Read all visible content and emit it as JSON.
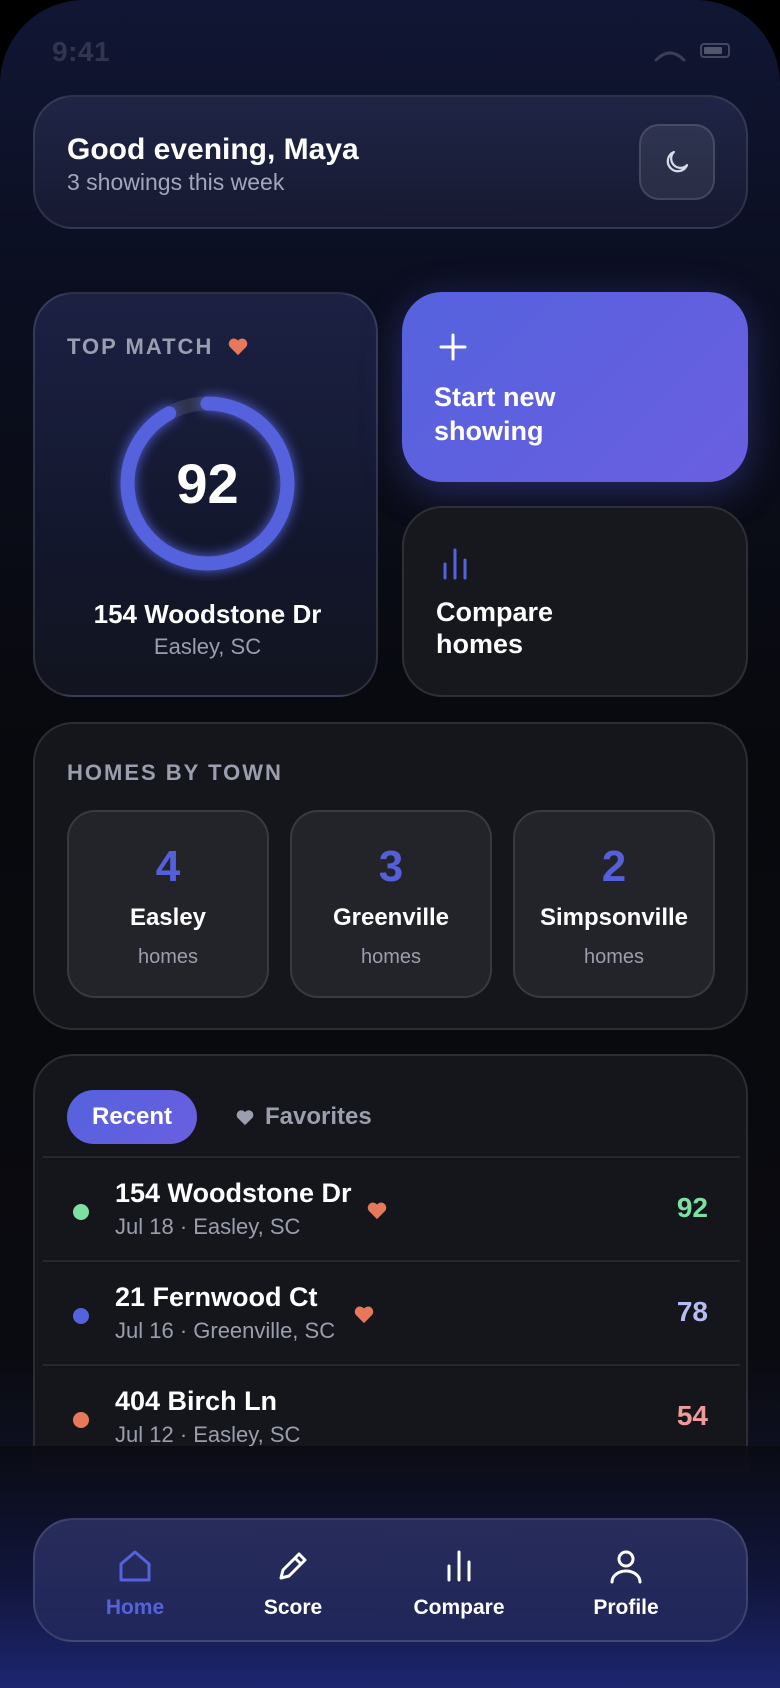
{
  "status": {
    "time": "9:41"
  },
  "greeting": {
    "title": "Good evening, Maya",
    "subtitle": "3 showings this week"
  },
  "top_match": {
    "label": "TOP MATCH",
    "score": "92",
    "score_fraction": 0.92,
    "address": "154 Woodstone Dr",
    "city": "Easley, SC"
  },
  "actions": {
    "start_label": "Start new showing",
    "compare_label": "Compare homes"
  },
  "towns": {
    "label": "HOMES BY TOWN",
    "items": [
      {
        "count": "4",
        "name": "Easley",
        "unit": "homes"
      },
      {
        "count": "3",
        "name": "Greenville",
        "unit": "homes"
      },
      {
        "count": "2",
        "name": "Simpsonville",
        "unit": "homes"
      }
    ]
  },
  "list": {
    "tabs": {
      "recent": "Recent",
      "favorites": "Favorites"
    },
    "rows": [
      {
        "title": "154 Woodstone Dr",
        "subtitle": "Jul 18 · Easley, SC",
        "score": "92",
        "favorite": true,
        "dot_color": "#7ee0a0",
        "score_color": "#7ee0a0"
      },
      {
        "title": "21 Fernwood Ct",
        "subtitle": "Jul 16 · Greenville, SC",
        "score": "78",
        "favorite": true,
        "dot_color": "#5562de",
        "score_color": "#b7bcf5"
      },
      {
        "title": "404 Birch Ln",
        "subtitle": "Jul 12 · Easley, SC",
        "score": "54",
        "favorite": false,
        "dot_color": "#e8785a",
        "score_color": "#f09a9a"
      }
    ]
  },
  "nav": {
    "items": [
      {
        "label": "Home",
        "icon": "home-icon",
        "active": true
      },
      {
        "label": "Score",
        "icon": "pencil-icon",
        "active": false
      },
      {
        "label": "Compare",
        "icon": "bar-chart-icon",
        "active": false
      },
      {
        "label": "Profile",
        "icon": "person-icon",
        "active": false
      }
    ]
  },
  "colors": {
    "accent": "#5562de",
    "accent_alt": "#6a5fe0",
    "heart": "#e8785a",
    "muted_text": "#9a9eaf"
  }
}
